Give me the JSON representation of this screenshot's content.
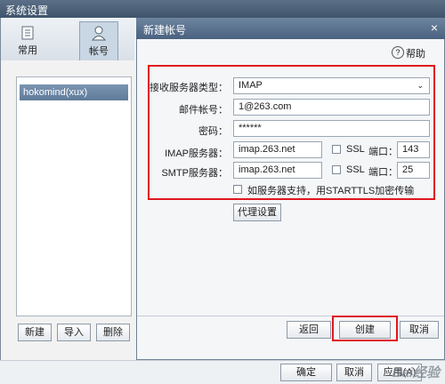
{
  "window": {
    "title": "系统设置"
  },
  "toolbar": {
    "common": {
      "label": "常用"
    },
    "account": {
      "label": "帐号"
    }
  },
  "account_list": {
    "items": [
      "hokomind(xux)"
    ]
  },
  "left_buttons": {
    "new": "新建",
    "import": "导入",
    "delete": "删除"
  },
  "dialog": {
    "title": "新建帐号",
    "close": "×",
    "help": "帮助",
    "help_icon": "?",
    "form": {
      "server_type_label": "接收服务器类型：",
      "server_type_value": "IMAP",
      "email_label": "邮件帐号：",
      "email_value": "1@263.com",
      "password_label": "密码：",
      "password_value": "******",
      "imap_label": "IMAP服务器：",
      "imap_value": "imap.263.net",
      "imap_ssl": "SSL",
      "imap_port_label": "端口：",
      "imap_port": "143",
      "smtp_label": "SMTP服务器：",
      "smtp_value": "imap.263.net",
      "smtp_ssl": "SSL",
      "smtp_port_label": "端口：",
      "smtp_port": "25",
      "starttls_label": "如服务器支持，用STARTTLS加密传输"
    },
    "proxy_button": "代理设置",
    "back_button": "返回",
    "create_button": "创建",
    "cancel_button": "取消"
  },
  "footer": {
    "ok": "确定",
    "cancel": "取消",
    "apply": "应用(A)",
    "watermark": "Bai经验"
  },
  "colors": {
    "highlight_box": "#e0161e",
    "title_bar": "#4a6280"
  }
}
